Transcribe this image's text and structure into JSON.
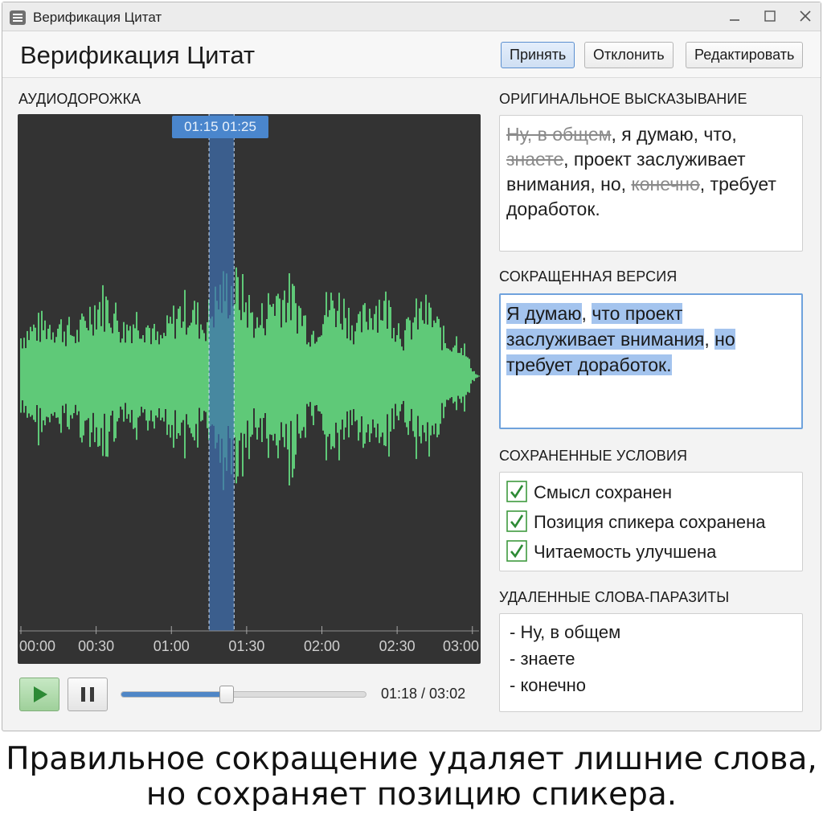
{
  "window": {
    "title": "Верификация Цитат",
    "icon": "document-icon",
    "controls": [
      "minimize-icon",
      "maximize-icon",
      "close-icon"
    ]
  },
  "header": {
    "title": "Верификация Цитат",
    "buttons": {
      "accept": "Принять",
      "reject": "Отклонить",
      "edit": "Редактировать"
    }
  },
  "audio": {
    "label": "АУДИОДОРОЖКА",
    "selection_label": "01:15  01:25",
    "selection_start": "01:15",
    "selection_end": "01:25",
    "ticks": [
      "00:00",
      "00:30",
      "01:00",
      "01:30",
      "02:00",
      "02:30",
      "03:00"
    ],
    "duration_seconds": 182,
    "position_fraction": 0.43,
    "time_readout": "01:18 / 03:02",
    "play_icon": "play-icon",
    "pause_icon": "pause-icon",
    "colors": {
      "waveform": "#5fc978",
      "selection": "#3f6fb0",
      "background": "#333333"
    }
  },
  "original": {
    "label": "ОРИГИНАЛЬНОЕ ВЫСКАЗЫВАНИЕ",
    "segments": [
      {
        "text": "Ну, в общем",
        "struck": true
      },
      {
        "text": ", я думаю, что, ",
        "struck": false
      },
      {
        "text": "знаете",
        "struck": true
      },
      {
        "text": ", проект заслуживает внимания, но, ",
        "struck": false
      },
      {
        "text": "конечно",
        "struck": true
      },
      {
        "text": ", требует доработок.",
        "struck": false
      }
    ]
  },
  "shortened": {
    "label": "СОКРАЩЕННАЯ ВЕРСИЯ",
    "segments": [
      {
        "text": "Я думаю",
        "highlighted": true
      },
      {
        "text": ", ",
        "highlighted": false
      },
      {
        "text": "что проект заслуживает внимания",
        "highlighted": true
      },
      {
        "text": ", ",
        "highlighted": false
      },
      {
        "text": "но требует доработок.",
        "highlighted": true
      }
    ]
  },
  "conditions": {
    "label": "СОХРАНЕННЫЕ УСЛОВИЯ",
    "items": [
      "Смысл сохранен",
      "Позиция спикера сохранена",
      "Читаемость улучшена"
    ],
    "checked": [
      true,
      true,
      true
    ],
    "check_icon": "checkbox-checked-icon"
  },
  "fillers": {
    "label": "УДАЛЕННЫЕ СЛОВА-ПАРАЗИТЫ",
    "items": [
      "- Ну, в общем",
      "- знаете",
      "- конечно"
    ]
  },
  "caption": {
    "line1": "Правильное сокращение удаляет лишние слова,",
    "line2": "но сохраняет позицию спикера."
  }
}
